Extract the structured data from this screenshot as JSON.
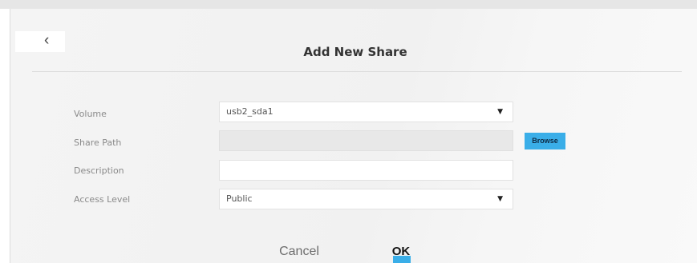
{
  "dialog": {
    "title": "Add New Share",
    "back_icon": "chevron-left-icon"
  },
  "form": {
    "volume": {
      "label": "Volume",
      "value": "usb2_sda1"
    },
    "share_path": {
      "label": "Share Path",
      "value": "",
      "browse_label": "Browse"
    },
    "description": {
      "label": "Description",
      "value": ""
    },
    "access_level": {
      "label": "Access Level",
      "value": "Public"
    }
  },
  "actions": {
    "cancel_label": "Cancel",
    "ok_label": "OK"
  },
  "colors": {
    "accent": "#3aaee8",
    "panel": "#f2f2f2",
    "field_disabled": "#e8e8e8"
  }
}
